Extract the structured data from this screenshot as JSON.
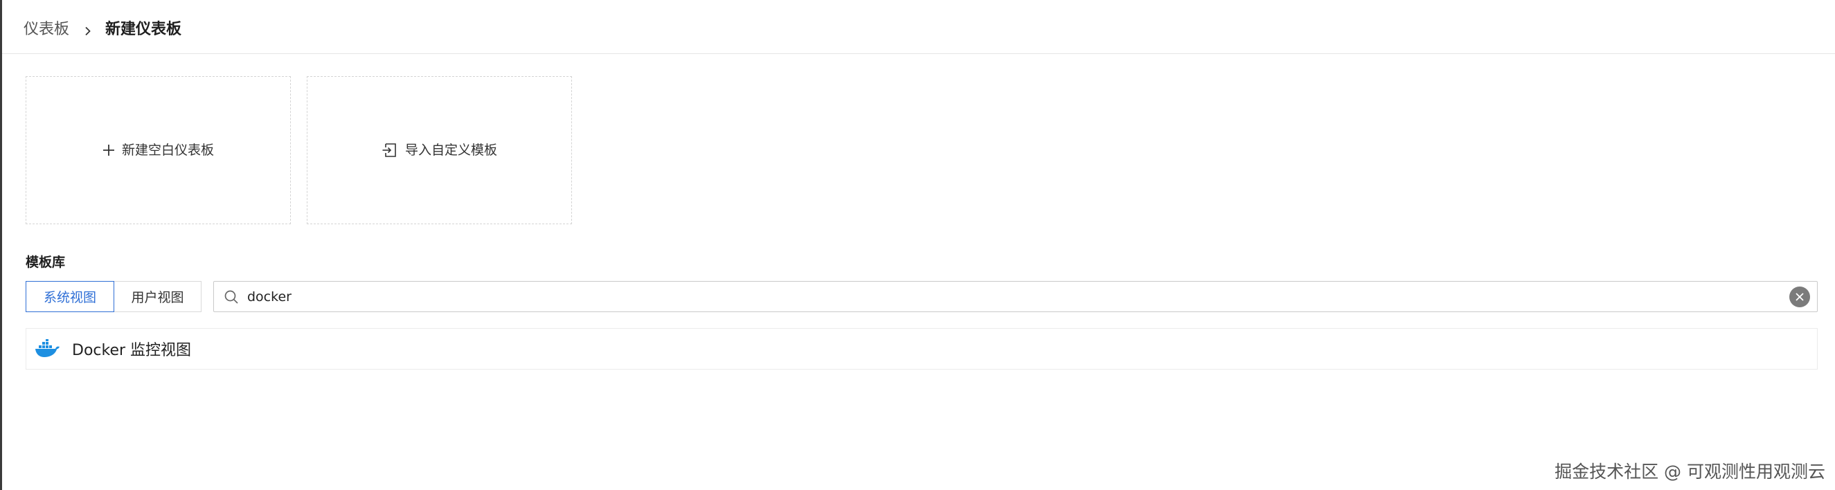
{
  "breadcrumb": {
    "parent": "仪表板",
    "current": "新建仪表板"
  },
  "cards": {
    "new_blank": "新建空白仪表板",
    "import_custom": "导入自定义模板"
  },
  "library": {
    "title": "模板库",
    "tabs": [
      {
        "label": "系统视图",
        "active": true
      },
      {
        "label": "用户视图",
        "active": false
      }
    ]
  },
  "search": {
    "value": "docker",
    "placeholder": ""
  },
  "results": [
    {
      "label": "Docker 监控视图",
      "icon": "docker-icon"
    }
  ],
  "watermark": "掘金技术社区 @ 可观测性用观测云",
  "colors": {
    "accent": "#2f6fd6",
    "docker_blue": "#1d8fe1"
  }
}
